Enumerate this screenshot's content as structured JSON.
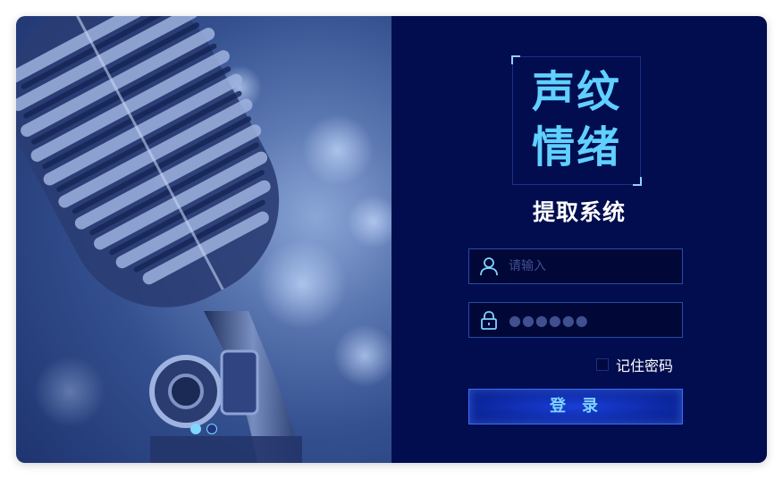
{
  "logo": {
    "line1": "声纹",
    "line2": "情绪",
    "subtitle": "提取系统"
  },
  "form": {
    "username": {
      "placeholder": "请输入",
      "icon": "user-icon"
    },
    "password": {
      "masked_value": "●●●●●●",
      "icon": "lock-icon"
    },
    "remember_label": "记住密码",
    "remember_checked": false,
    "login_label": "登录"
  },
  "carousel": {
    "slide_count": 2,
    "active_index": 0
  },
  "colors": {
    "panel_bg": "#020d4f",
    "accent": "#5fd0ff",
    "button": "#1a3fd6",
    "field_border": "#2a4aa8"
  }
}
